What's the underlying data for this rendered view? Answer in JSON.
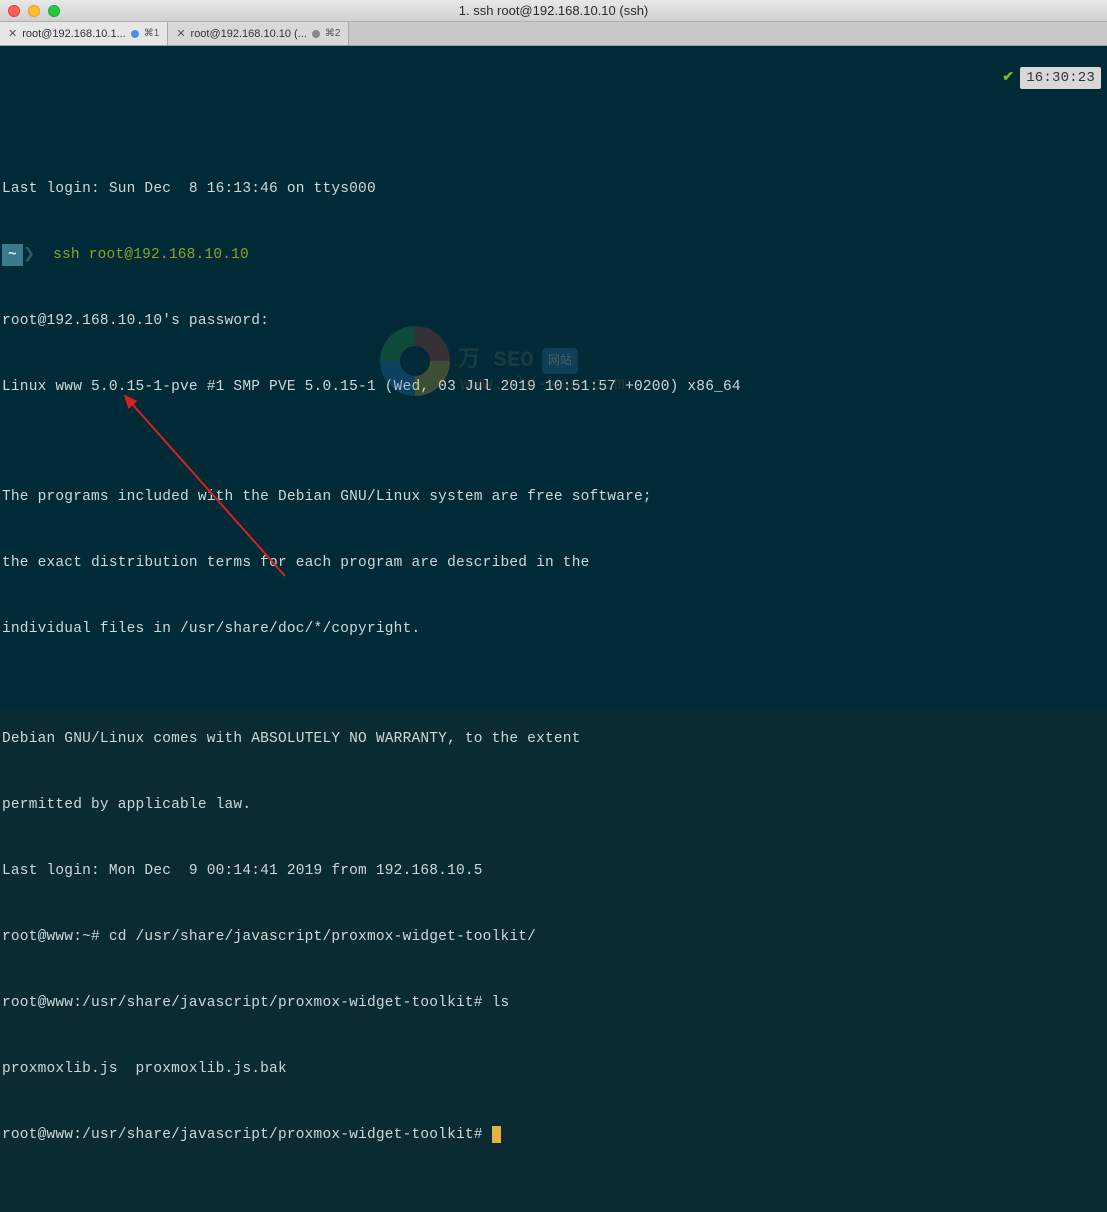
{
  "window": {
    "title": "1. ssh root@192.168.10.10 (ssh)"
  },
  "tabs": [
    {
      "label": "root@192.168.10.1... ",
      "shortcut": "⌘1",
      "active": true,
      "indicator": "blue"
    },
    {
      "label": "root@192.168.10.10 (... ",
      "shortcut": "⌘2",
      "active": false,
      "indicator": "gray"
    }
  ],
  "clock": {
    "time": "16:30:23"
  },
  "terminal": {
    "lines": [
      "Last login: Sun Dec  8 16:13:46 on ttys000",
      "",
      "root@192.168.10.10's password:",
      "Linux www 5.0.15-1-pve #1 SMP PVE 5.0.15-1 (Wed, 03 Jul 2019 10:51:57 +0200) x86_64",
      "",
      "The programs included with the Debian GNU/Linux system are free software;",
      "the exact distribution terms for each program are described in the",
      "individual files in /usr/share/doc/*/copyright.",
      "",
      "Debian GNU/Linux comes with ABSOLUTELY NO WARRANTY, to the extent",
      "permitted by applicable law.",
      "Last login: Mon Dec  9 00:14:41 2019 from 192.168.10.5",
      "root@www:~# cd /usr/share/javascript/proxmox-widget-toolkit/",
      "root@www:/usr/share/javascript/proxmox-widget-toolkit# ls",
      "proxmoxlib.js  proxmoxlib.js.bak",
      "root@www:/usr/share/javascript/proxmox-widget-toolkit# "
    ],
    "prompt_cwd": "~",
    "prompt_cmd_1": "ssh",
    "prompt_cmd_2": "root@192.168.10.10"
  },
  "watermark": {
    "text_cn": "万 SEO",
    "badge": "网站",
    "url": "www.old-wan.com"
  }
}
